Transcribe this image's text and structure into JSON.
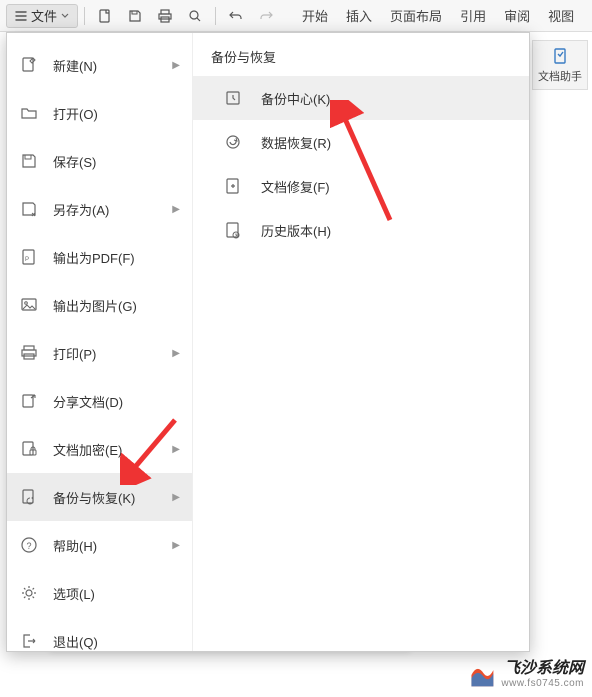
{
  "toolbar": {
    "file_label": "文件"
  },
  "tabs": {
    "start": "开始",
    "insert": "插入",
    "layout": "页面布局",
    "reference": "引用",
    "review": "审阅",
    "view": "视图"
  },
  "helper": {
    "label": "文档助手"
  },
  "menu": {
    "new": "新建(N)",
    "open": "打开(O)",
    "save": "保存(S)",
    "saveas": "另存为(A)",
    "exportpdf": "输出为PDF(F)",
    "exportimg": "输出为图片(G)",
    "print": "打印(P)",
    "share": "分享文档(D)",
    "encrypt": "文档加密(E)",
    "backup": "备份与恢复(K)",
    "help": "帮助(H)",
    "options": "选项(L)",
    "exit": "退出(Q)"
  },
  "submenu": {
    "title": "备份与恢复",
    "backup_center": "备份中心(K)...",
    "data_recover": "数据恢复(R)",
    "doc_repair": "文档修复(F)",
    "history": "历史版本(H)"
  },
  "watermark": {
    "main": "飞沙系统网",
    "sub": "www.fs0745.com"
  }
}
